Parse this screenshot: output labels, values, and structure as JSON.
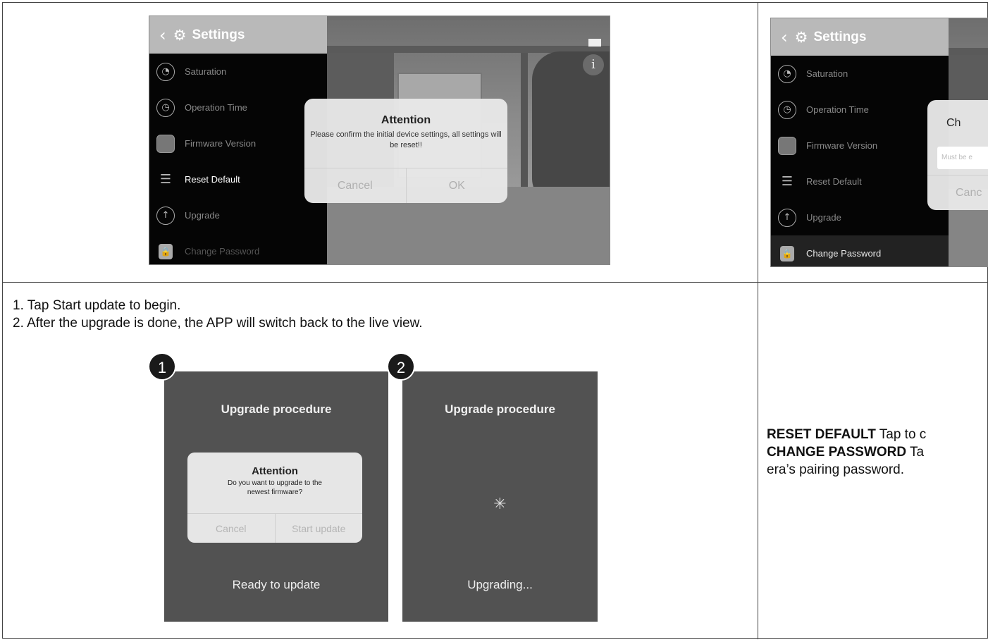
{
  "settings_screen": {
    "title": "Settings",
    "menu": [
      "Saturation",
      "Operation Time",
      "Firmware Version",
      "Reset Default",
      "Upgrade",
      "Change Password"
    ]
  },
  "reset_dialog": {
    "title": "Attention",
    "message": "Please confirm the initial device settings, all settings will be reset!!",
    "cancel": "Cancel",
    "ok": "OK"
  },
  "password_dialog": {
    "title_partial": "Ch",
    "placeholder_partial": "Must be e",
    "cancel_partial": "Canc"
  },
  "steps": [
    "1. Tap Start update to begin.",
    "2. After the upgrade is done, the APP will switch back to the live view."
  ],
  "upgrade_screens": {
    "badge_1": "1",
    "badge_2": "2",
    "title": "Upgrade procedure",
    "dialog_title": "Attention",
    "dialog_message": "Do you want to upgrade to the newest firmware?",
    "cancel": "Cancel",
    "start_update": "Start update",
    "ready_status": "Ready to update",
    "upgrading_status": "Upgrading..."
  },
  "right_text": {
    "reset_label": "RESET DEFAULT",
    "reset_desc": " Tap to c",
    "change_label": "CHANGE PASSWORD",
    "change_desc": " Ta",
    "line3": "era’s pairing password."
  }
}
